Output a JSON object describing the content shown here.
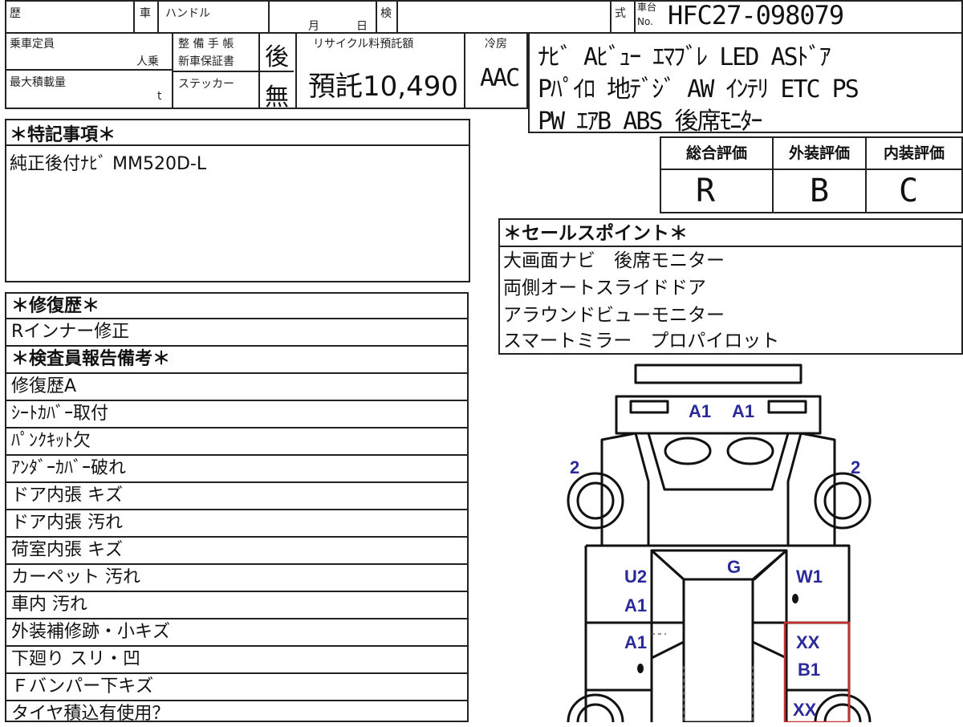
{
  "header": {
    "history_label": "歴",
    "vehicle_label": "車",
    "handle_label": "ハンドル",
    "month_label": "月",
    "day_label": "日",
    "inspection_label": "検",
    "model_label": "式",
    "chassis_label_top": "車台",
    "chassis_label_bottom": "No.",
    "chassis_number": "HFC27-098079"
  },
  "spec": {
    "capacity_label": "乗車定員",
    "capacity_unit": "人乗",
    "load_label": "最大積載量",
    "load_unit": "t",
    "maintenance_label": "整 備 手 帳",
    "warranty_label": "新車保証書",
    "sticker_label": "ステッカー",
    "maintenance_value": "後",
    "sticker_value": "無",
    "recycle_label": "リサイクル料預託額",
    "recycle_value": "預託10,490",
    "ac_label": "冷房",
    "ac_value": "AAC"
  },
  "equipment": {
    "lines": [
      "ﾅﾋﾞ Aﾋﾞｭｰ ｴﾏﾌﾞﾚ LED ASﾄﾞｱ",
      "Pﾊﾟｲﾛ 地ﾃﾞｼﾞ AW ｲﾝﾃﾘ ETC PS",
      "PW ｴｱB ABS 後席ﾓﾆﾀｰ"
    ]
  },
  "special_notes": {
    "title": "＊特記事項＊",
    "text": "純正後付ﾅﾋﾞ MM520D-L"
  },
  "evaluation": {
    "overall_label": "総合評価",
    "exterior_label": "外装評価",
    "interior_label": "内装評価",
    "overall": "R",
    "exterior": "B",
    "interior": "C"
  },
  "sales_points": {
    "title": "＊セールスポイント＊",
    "items": [
      "大画面ナビ　後席モニター",
      "両側オートスライドドア",
      "アラウンドビューモニター",
      "スマートミラー　プロパイロット"
    ]
  },
  "repair": {
    "title": "＊修復歴＊",
    "text": "Rインナー修正"
  },
  "inspector": {
    "title": "＊検査員報告備考＊",
    "items": [
      "修復歴A",
      "ｼｰﾄｶﾊﾞｰ取付",
      "ﾊﾟﾝｸｷｯﾄ欠",
      "ｱﾝﾀﾞｰｶﾊﾞｰ破れ",
      "ドア内張 キズ",
      "ドア内張 汚れ",
      "荷室内張 キズ",
      "カーペット 汚れ",
      "車内 汚れ",
      "外装補修跡・小キズ",
      "下廻り スリ・凹",
      "Ｆバンパー下キズ",
      "タイヤ積込有使用？"
    ]
  },
  "diagram": {
    "marks": {
      "front_a1_left": "A1",
      "front_a1_right": "A1",
      "left_front_wheel": "2",
      "right_front_wheel": "2",
      "roof": "G",
      "left_front_door_1": "U2",
      "left_front_door_2": "A1",
      "left_rear_door": "A1",
      "right_front_door": "W1",
      "right_rear_door_1": "XX",
      "right_rear_door_2": "B1",
      "right_rear_quarter": "XX"
    },
    "accent_color": "#2a2a9a",
    "highlight_color": "#c83030"
  }
}
